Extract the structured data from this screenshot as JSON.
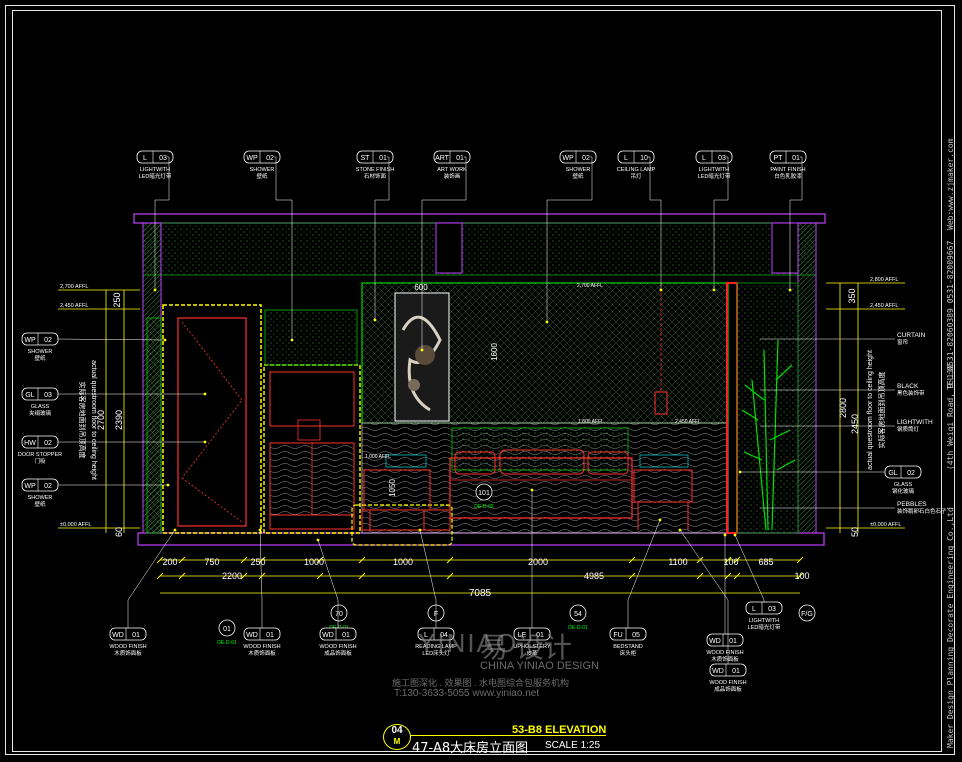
{
  "title_block": {
    "company": "Maker Design Planning Decorate Engineering Co.,Ltd",
    "address": "(4th Weiqi Road, 9-110",
    "tel": "TEL:0531-82060389 0531-82009667",
    "web": "Web:www.zjmaker.com"
  },
  "drawing_title": {
    "number": "04",
    "sheet": "M",
    "english": "53-B8 ELEVATION",
    "chinese": "47-A8大床房立面图",
    "scale": "SCALE 1:25"
  },
  "watermark": {
    "logo": "YINIAO",
    "chinese": "易  设计",
    "english": "CHINA YINIAO DESIGN",
    "line": "施工图深化 . 效果图 . 水电图综合包服务机构",
    "contact": "T:130-3633-5055  www.yiniao.net"
  },
  "top_tags": [
    {
      "code": "L",
      "num": "03",
      "en": "LIGHTWITH",
      "cn": "LED暗光灯带"
    },
    {
      "code": "WP",
      "num": "02",
      "en": "SHOWER",
      "cn": "壁纸"
    },
    {
      "code": "ST",
      "num": "01",
      "en": "STONE FINISH",
      "cn": "石材饰面"
    },
    {
      "code": "ART",
      "num": "01",
      "en": "ART WORK",
      "cn": "装饰画"
    },
    {
      "code": "WP",
      "num": "02",
      "en": "SHOWER",
      "cn": "壁纸"
    },
    {
      "code": "L",
      "num": "10",
      "en": "CEILING LAMP",
      "cn": "吊灯"
    },
    {
      "code": "L",
      "num": "03",
      "en": "LIGHTWITH",
      "cn": "LED暗光灯带"
    },
    {
      "code": "PT",
      "num": "01",
      "en": "PAINT FINISH",
      "cn": "白色乳胶漆"
    }
  ],
  "left_tags": [
    {
      "code": "WP",
      "num": "02",
      "en": "SHOWER",
      "cn": "壁纸"
    },
    {
      "code": "GL",
      "num": "03",
      "en": "GLASS",
      "cn": "夹绢玻璃"
    },
    {
      "code": "HW",
      "num": "02",
      "en": "DOOR STOPPER",
      "cn": "门吸"
    },
    {
      "code": "WP",
      "num": "02",
      "en": "SHOWER",
      "cn": "壁纸"
    }
  ],
  "right_labels": [
    {
      "en": "CURTAIN",
      "cn": "窗帘"
    },
    {
      "en": "BLACK",
      "cn": "黑色装饰带"
    },
    {
      "en": "LIGHTWITH",
      "cn": "钢质筒灯"
    },
    {
      "en": "PEBBLES",
      "cn": "装饰鹅卵石白色石子"
    }
  ],
  "right_tag": {
    "code": "GL",
    "num": "02",
    "en": "GLASS",
    "cn": "钢化玻璃"
  },
  "bottom_tags": [
    {
      "code": "WD",
      "num": "01",
      "en": "WOOD FINISH",
      "cn": "木质饰面板"
    },
    {
      "code": "WD",
      "num": "01",
      "en": "WOOD FINISH",
      "cn": "木质饰面板"
    },
    {
      "code": "WD",
      "num": "01",
      "en": "WOOD FINISH",
      "cn": "成品饰面板"
    },
    {
      "code": "L",
      "num": "04",
      "en": "READING LAMP",
      "cn": "LED床头灯"
    },
    {
      "code": "LE",
      "num": "01",
      "en": "UPHOLSTERY",
      "cn": "皮革"
    },
    {
      "code": "FU",
      "num": "05",
      "en": "BEDSTAND",
      "cn": "床头柜"
    },
    {
      "code": "WD",
      "num": "01",
      "en": "WOOD FINISH",
      "cn": "木质饰面板"
    },
    {
      "code": "WD",
      "num": "01",
      "en": "WOOD FINISH",
      "cn": "成品饰面板"
    },
    {
      "code": "L",
      "num": "03",
      "en": "LIGHTWITH",
      "cn": "LED暗光灯带"
    }
  ],
  "section_refs": [
    {
      "num": "01",
      "sheet": "DE-D-01"
    },
    {
      "num": "70",
      "sheet": "DE-D-01"
    },
    {
      "num": "F",
      "sheet": ""
    },
    {
      "num": "54",
      "sheet": "DE-D-01"
    },
    {
      "num": "F/G",
      "sheet": ""
    },
    {
      "num": "101",
      "sheet": "DE-D-02"
    }
  ],
  "levels_left": [
    "2,700 AFFL",
    "2,450 AFFL",
    "±0,000 AFFL"
  ],
  "levels_right": [
    "2,800 AFFL",
    "2,450 AFFL",
    "±0,000 AFFL"
  ],
  "inner_levels": [
    "2,700 AFFL",
    "1,800 AFFL",
    "1,000 AFFL",
    "2,450 AFFL"
  ],
  "dims_left": [
    "250",
    "2700",
    "2390",
    "60"
  ],
  "dims_right": [
    "350",
    "2800",
    "2450",
    "50"
  ],
  "dims_bottom_row1": [
    "200",
    "750",
    "250",
    "1000",
    "1000",
    "2000",
    "1100",
    "100",
    "685"
  ],
  "dims_bottom_row2": [
    "2200",
    "4985",
    "100"
  ],
  "dims_total": "7085",
  "dims_inner": [
    "600",
    "1600",
    "1050"
  ],
  "ceiling_note_left": "actual questroom floor to ceiling height",
  "ceiling_note_left_cn": "实际客房地面到吊顶高度",
  "ceiling_note_right": "actual questroom floor to ceiling height",
  "ceiling_note_right_cn": "实际客房地面到吊顶高度",
  "colors": {
    "bg": "#000000",
    "frame": "#e8e8e8",
    "yellow": "#ffff00",
    "green": "#00ff00",
    "red": "#ff2020",
    "magenta": "#c040ff",
    "white": "#ffffff",
    "cyan": "#00c0c0"
  }
}
